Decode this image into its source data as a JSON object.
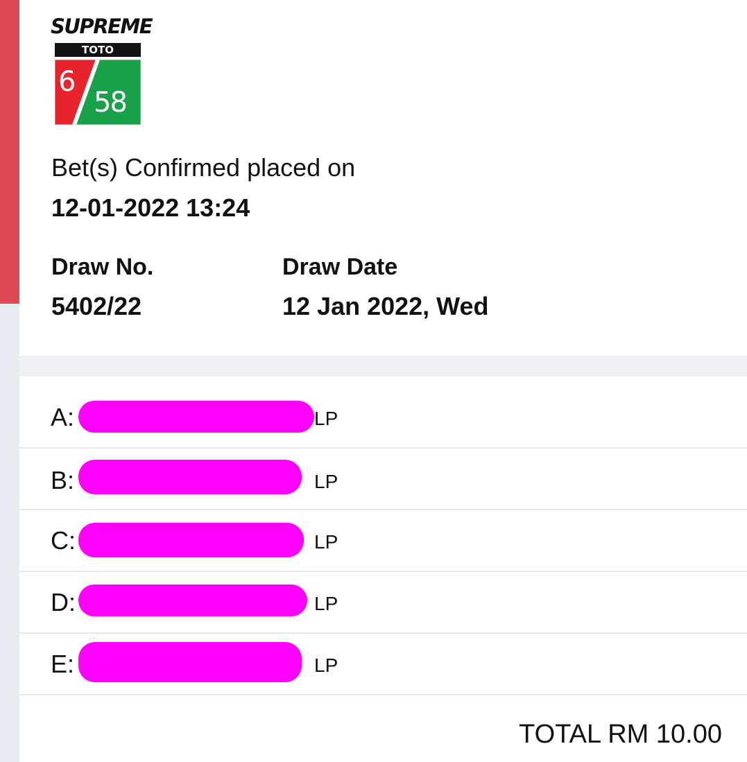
{
  "logo": {
    "brand": "SUPREME",
    "game": "TOTO",
    "digit_left": "6",
    "digit_right": "58",
    "colors": {
      "red": "#e8232b",
      "green": "#19a14a",
      "black": "#111111"
    }
  },
  "confirmation": {
    "label": "Bet(s) Confirmed placed on",
    "datetime": "12-01-2022 13:24"
  },
  "draw": {
    "number_label": "Draw No.",
    "number_value": "5402/22",
    "date_label": "Draw Date",
    "date_value": "12 Jan 2022, Wed"
  },
  "bets": [
    {
      "letter": "A:",
      "type": "LP"
    },
    {
      "letter": "B:",
      "type": "LP"
    },
    {
      "letter": "C:",
      "type": "LP"
    },
    {
      "letter": "D:",
      "type": "LP"
    },
    {
      "letter": "E:",
      "type": "LP"
    }
  ],
  "total": "TOTAL RM 10.00",
  "colors": {
    "accent": "#e04a55",
    "redaction": "#ff00ff",
    "background": "#eff1f5"
  }
}
